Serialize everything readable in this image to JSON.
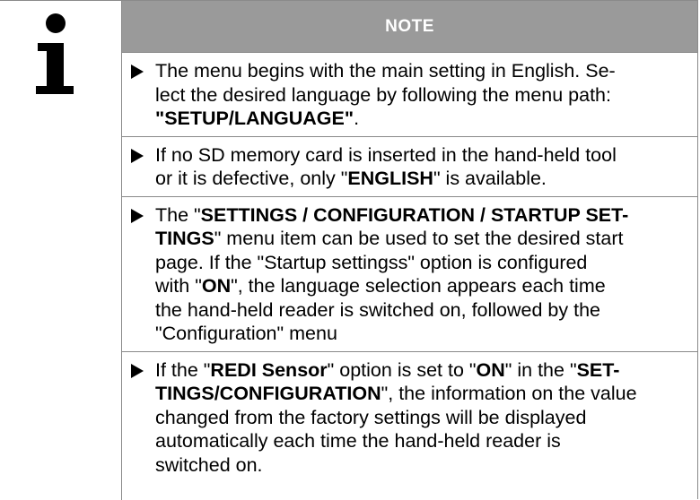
{
  "note": {
    "title": "NOTE",
    "icon": "info-icon",
    "items": [
      {
        "line1": "The menu begins with the main setting in English. Se-",
        "line2": "lect the desired language by following the menu path:",
        "path": "\"SETUP/LANGUAGE\"",
        "end": "."
      },
      {
        "line1": "If no SD memory card is inserted in the hand-held tool",
        "line2_pre": "or it is defective, only \"",
        "english": "ENGLISH",
        "line2_post": "\" is available."
      },
      {
        "pre": "The \"",
        "bold1a": "SETTINGS / CONFIGURATION / STARTUP SET-",
        "bold1b": "TINGS",
        "mid1": "\" menu item can be used to set the desired start",
        "line3": "page. If the \"Startup settingss\" option is configured",
        "with": "with \"",
        "on": "ON",
        "rest": "\", the language selection appears each time",
        "line5": "the hand-held reader is switched on, followed by the",
        "line6": "\"Configuration\" menu"
      },
      {
        "pre": "If the \"",
        "redi": "REDI Sensor",
        "mid": "\" option is set to \"",
        "on": "ON",
        "mid2": "\" in the \"",
        "set": "SET-",
        "tings": "TINGS/CONFIGURATION",
        "rest1": "\", the information on the value",
        "line3": "changed from the factory settings will be displayed",
        "line4": "automatically each time the hand-held reader is",
        "line5": "switched on."
      }
    ]
  },
  "colors": {
    "header_bg": "#9a9a9a",
    "header_text": "#ffffff",
    "border": "#8a8a8a",
    "text": "#000000"
  }
}
